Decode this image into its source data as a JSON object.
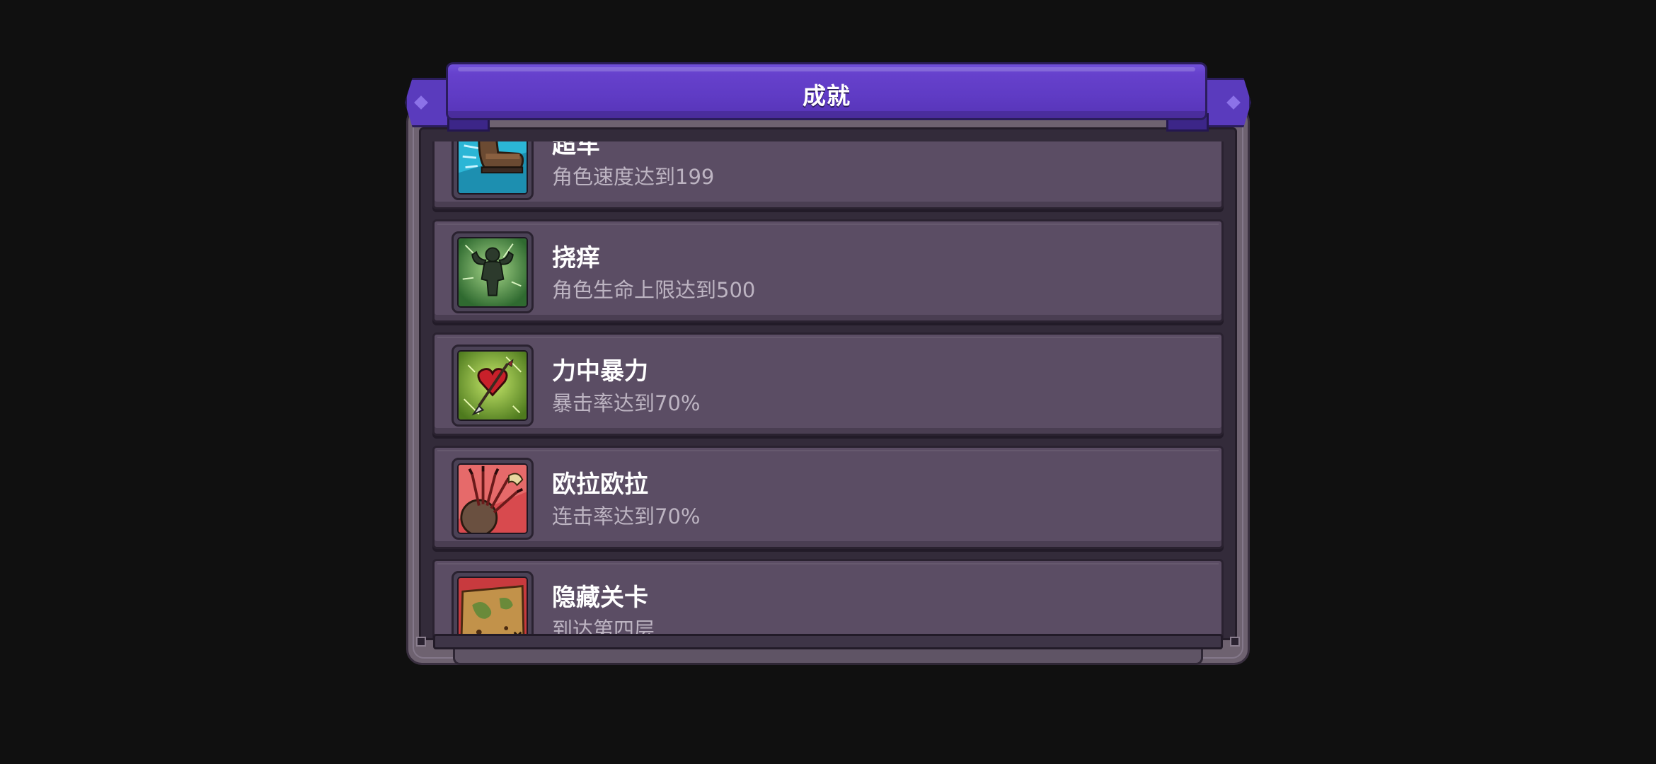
{
  "header": {
    "title": "成就"
  },
  "achievements": [
    {
      "name": "超车",
      "desc": "角色速度达到199",
      "icon": "speed-boot-icon"
    },
    {
      "name": "挠痒",
      "desc": "角色生命上限达到500",
      "icon": "muscle-figure-icon"
    },
    {
      "name": "力中暴力",
      "desc": "暴击率达到70%",
      "icon": "heart-arrow-icon"
    },
    {
      "name": "欧拉欧拉",
      "desc": "连击率达到70%",
      "icon": "arrow-volley-icon"
    },
    {
      "name": "隐藏关卡",
      "desc": "到达第四层",
      "icon": "treasure-map-icon"
    }
  ],
  "colors": {
    "ribbon": "#5f3bc4",
    "panel": "#5b4d64",
    "frame": "#6e6270",
    "background": "#101010"
  }
}
